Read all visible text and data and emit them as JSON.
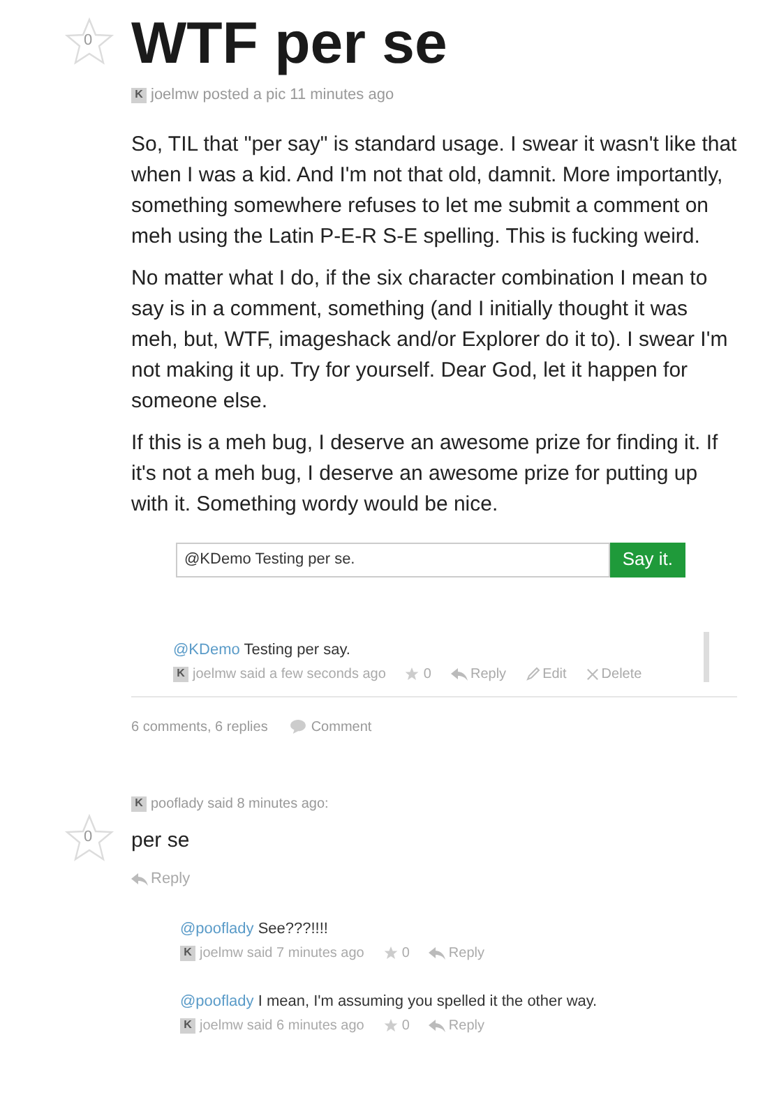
{
  "post": {
    "votes": "0",
    "title": "WTF per se",
    "meta": {
      "avatar": "K",
      "text": "joelmw posted a pic 11 minutes ago"
    },
    "paragraphs": [
      "So, TIL that \"per say\" is standard usage. I swear it wasn't like that when I was a kid. And I'm not that old, damnit. More importantly, something somewhere refuses to let me submit a comment on meh using the Latin P-E-R S-E spelling. This is fucking weird.",
      "No matter what I do, if the six character combination I mean to say is in a comment, something (and I initially thought it was meh, but, WTF, imageshack and/or Explorer do it to). I swear I'm not making it up. Try for yourself. Dear God, let it happen for someone else.",
      "If this is a meh bug, I deserve an awesome prize for finding it. If it's not a meh bug, I deserve an awesome prize for putting up with it. Something wordy would be nice."
    ],
    "composer": {
      "value": "@KDemo Testing per se.",
      "button": "Say it."
    },
    "comment": {
      "mention": "@KDemo",
      "text": "Testing per say.",
      "avatar": "K",
      "meta": "joelmw said a few seconds ago",
      "stars": "0",
      "reply": "Reply",
      "edit": "Edit",
      "delete": "Delete"
    },
    "summary": "6 comments, 6 replies",
    "comment_link": "Comment"
  },
  "comments": [
    {
      "votes": "0",
      "avatar": "K",
      "meta": "pooflady said 8 minutes ago:",
      "text": "per se",
      "reply": "Reply",
      "replies": [
        {
          "mention": "@pooflady",
          "text": "See???!!!!",
          "avatar": "K",
          "meta": "joelmw said 7 minutes ago",
          "stars": "0",
          "reply": "Reply"
        },
        {
          "mention": "@pooflady",
          "text": "I mean, I'm assuming you spelled it the other way.",
          "avatar": "K",
          "meta": "joelmw said 6 minutes ago",
          "stars": "0",
          "reply": "Reply"
        }
      ]
    }
  ]
}
